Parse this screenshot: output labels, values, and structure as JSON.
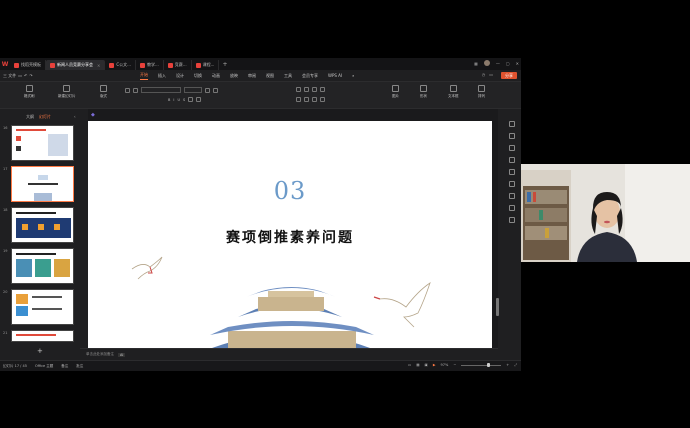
{
  "app": {
    "logo": "W",
    "tabs": [
      {
        "label": "找稻壳模板"
      },
      {
        "label": "新闻人员竞赛分享会"
      },
      {
        "label": "C公文..."
      },
      {
        "label": "教学..."
      },
      {
        "label": "竞赛..."
      },
      {
        "label": "课程..."
      }
    ],
    "tab_plus": "+"
  },
  "menubar": {
    "file_label": "三 文件",
    "items": [
      "开始",
      "插入",
      "设计",
      "切换",
      "动画",
      "放映",
      "审阅",
      "视图",
      "工具",
      "会员专享",
      "WPS AI"
    ],
    "active_index": 0,
    "share_label": "分享"
  },
  "ribbon": {
    "groups": [
      "格式刷",
      "新建幻灯片",
      "版式",
      "图片",
      "形状",
      "文本框",
      "排列"
    ]
  },
  "sidebar": {
    "tabs": [
      "大纲",
      "幻灯片"
    ],
    "active_tab": 1,
    "slide_numbers": [
      "16",
      "17",
      "18",
      "19",
      "20",
      "21"
    ],
    "selected_index": 1,
    "add_label": "+"
  },
  "slide": {
    "number": "03",
    "title": "赛项倒推素养问题"
  },
  "notes": {
    "placeholder": "单击此处添加备注",
    "tag": "AI"
  },
  "status": {
    "left": [
      "幻灯片 17 / 45",
      "Office 主题",
      "备注",
      "批注"
    ],
    "zoom": "97%"
  },
  "colors": {
    "accent": "#ff7a45",
    "slide_number": "#6b9ac9",
    "roof_blue": "#5c7fb4",
    "crane": "#ffffff"
  }
}
